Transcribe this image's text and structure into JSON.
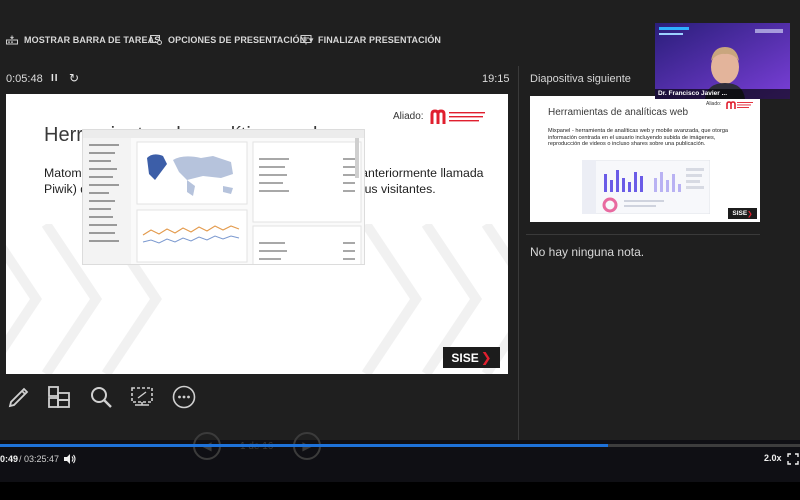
{
  "toolbar": {
    "taskbar_label": "MOSTRAR BARRA DE TAREAS",
    "options_label": "OPCIONES DE PRESENTACIÓN ▾",
    "end_label": "FINALIZAR PRESENTACIÓN"
  },
  "timer": {
    "elapsed": "0:05:48",
    "pause_symbol": "II",
    "reset_symbol": "↻",
    "clock": "19:15"
  },
  "current_slide": {
    "title": "Herramientas de analíticas web",
    "body": "Matomo - plataforma de analíticas web de código abierto (anteriormente llamada Piwik) que brinda reportes detallados sobre tu sitio web y sus visitantes.",
    "aliado": "Aliado:",
    "sise_label": "SISE",
    "accent_color": "#e01f2e"
  },
  "next_panel": {
    "label": "Diapositiva siguiente",
    "title": "Herramientas de analíticas web",
    "body": "Mixpanel - herramienta de analíticas web y mobile avanzada, que otorga información centrada en el usuario incluyendo subida de imágenes, reproducción de videos o incluso shares sobre una publicación.",
    "aliado": "Aliado:",
    "sise_label": "SISE"
  },
  "notes": {
    "text": "No hay ninguna nota."
  },
  "webcam": {
    "name": "Dr. Francisco Javier ..."
  },
  "player": {
    "current_time": "0:49",
    "total_time": "/ 03:25:47",
    "speed": "2.0x",
    "slide_counter": "1 de 16",
    "progress_fraction": 0.76,
    "progress_color": "#1e72d9"
  },
  "icons": {
    "tools": [
      "pen-icon",
      "slides-grid-icon",
      "zoom-icon",
      "screen-icon",
      "more-icon"
    ]
  }
}
